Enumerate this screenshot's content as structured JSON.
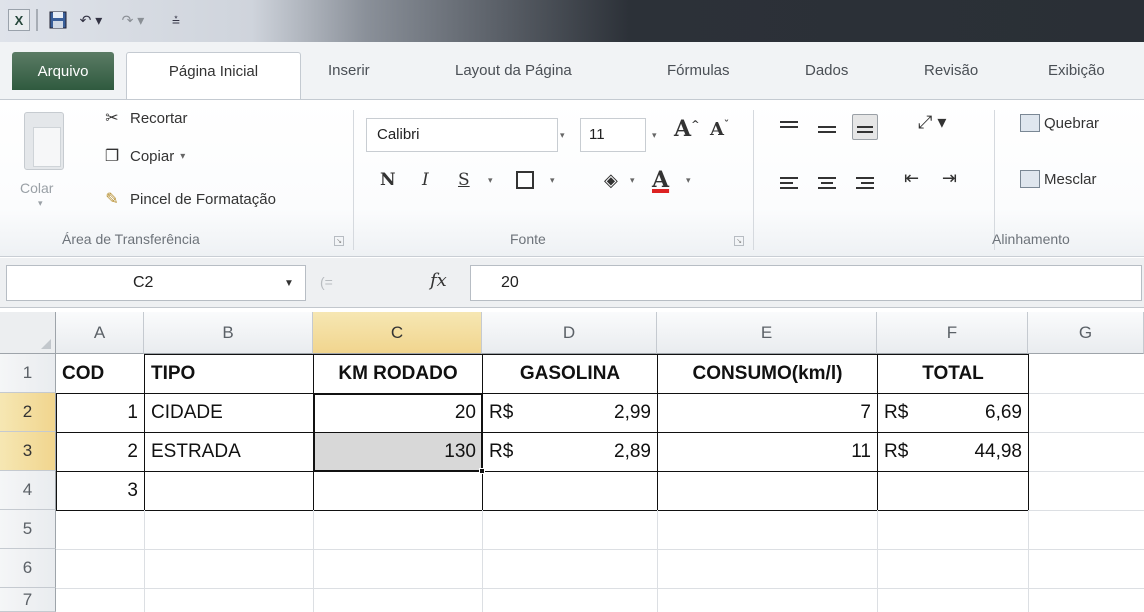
{
  "quick_access": {
    "excel_icon": "X",
    "save_icon": "save-icon",
    "undo_icon": "undo-icon",
    "redo_icon": "redo-icon",
    "customize_icon": "customize-icon"
  },
  "tabs": {
    "file": "Arquivo",
    "home": "Página Inicial",
    "insert": "Inserir",
    "page_layout": "Layout da Página",
    "formulas": "Fórmulas",
    "data": "Dados",
    "review": "Revisão",
    "view": "Exibição"
  },
  "ribbon": {
    "clipboard": {
      "paste": "Colar",
      "cut": "Recortar",
      "copy": "Copiar",
      "format_painter": "Pincel de Formatação",
      "group_label": "Área de Transferência"
    },
    "font": {
      "font_name": "Calibri",
      "font_size": "11",
      "bold": "N",
      "italic": "I",
      "underline": "S",
      "grow": "A",
      "shrink": "A",
      "font_color": "A",
      "group_label": "Fonte"
    },
    "alignment": {
      "wrap_text": "Quebrar",
      "merge": "Mesclar",
      "group_label": "Alinhamento"
    }
  },
  "formula_bar": {
    "name_box": "C2",
    "fx": "fx",
    "value": "20"
  },
  "sheet": {
    "columns": [
      "A",
      "B",
      "C",
      "D",
      "E",
      "F",
      "G"
    ],
    "rows": [
      "1",
      "2",
      "3",
      "4",
      "5",
      "6",
      "7"
    ],
    "selected_column": "C",
    "selected_rows": [
      "2",
      "3"
    ],
    "header": {
      "a": "COD",
      "b": "TIPO",
      "c": "KM RODADO",
      "d": "GASOLINA",
      "e": "CONSUMO(km/l)",
      "f": "TOTAL"
    },
    "data": [
      {
        "a": "1",
        "b": "CIDADE",
        "c": "20",
        "d_cur": "R$",
        "d_val": "2,99",
        "e": "7",
        "f_cur": "R$",
        "f_val": "6,69"
      },
      {
        "a": "2",
        "b": "ESTRADA",
        "c": "130",
        "d_cur": "R$",
        "d_val": "2,89",
        "e": "11",
        "f_cur": "R$",
        "f_val": "44,98"
      },
      {
        "a": "3",
        "b": "",
        "c": "",
        "d_cur": "",
        "d_val": "",
        "e": "",
        "f_cur": "",
        "f_val": ""
      }
    ]
  }
}
